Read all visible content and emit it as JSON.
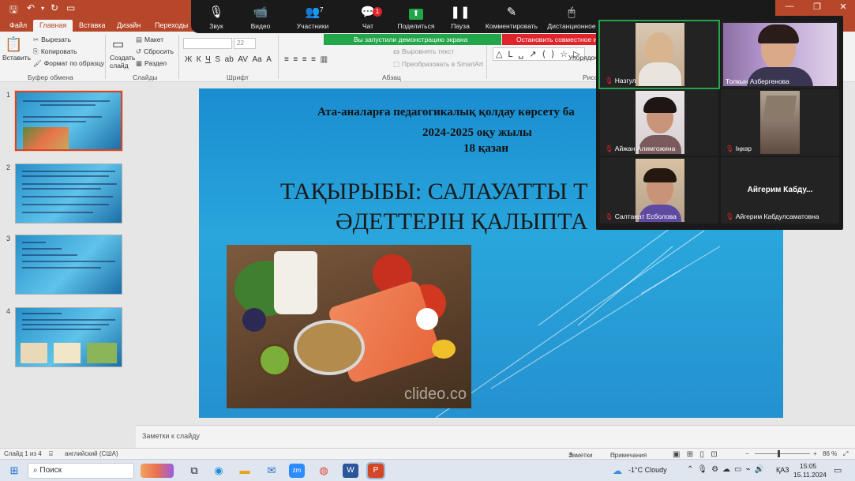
{
  "titlebar": {
    "color": "#b7472a",
    "save_icon": "save-icon",
    "undo_icon": "undo-icon",
    "restore_icon": "restore-icon",
    "close_icon": "close-icon"
  },
  "ribbon_tabs": [
    "Файл",
    "Главная",
    "Вставка",
    "Дизайн",
    "Переходы"
  ],
  "ribbon": {
    "paste": "Вставить",
    "cut": "Вырезать",
    "copy": "Копировать",
    "format_painter": "Формат по образцу",
    "clipboard_group": "Буфер обмена",
    "new_slide": "Создать слайд",
    "layout": "Макет",
    "reset": "Сбросить",
    "section": "Раздел",
    "slides_group": "Слайды",
    "font_size": "22",
    "font_group": "Шрифт",
    "paragraph_group": "Абзац",
    "align_text": "Выровнять текст",
    "convert_smartart": "Преобразовать в SmartArt",
    "arrange": "Упорядоч",
    "drawing_group_partial": "Рисо"
  },
  "zoom_toolbar": {
    "items": [
      {
        "icon": "microphone-icon",
        "label": "Звук"
      },
      {
        "icon": "video-camera-icon",
        "label": "Видео"
      },
      {
        "icon": "participants-icon",
        "label": "Участники",
        "count": "7"
      },
      {
        "icon": "chat-icon",
        "label": "Чат",
        "badge": "1"
      },
      {
        "icon": "share-screen-icon",
        "label": "Поделиться"
      },
      {
        "icon": "pause-icon",
        "label": "Пауза"
      },
      {
        "icon": "annotate-icon",
        "label": "Комментировать"
      },
      {
        "icon": "remote-control-icon",
        "label": "Дистанционное"
      }
    ],
    "sharing_notice": "Вы запустили демонстрацию экрана",
    "stop_sharing": "Остановить совместное испо"
  },
  "thumbnails": [
    {
      "number": "1",
      "selected": true
    },
    {
      "number": "2",
      "selected": false
    },
    {
      "number": "3",
      "selected": false
    },
    {
      "number": "4",
      "selected": false
    }
  ],
  "slide": {
    "line1": "Ата-аналарға педагогикалық қолдау көрсету ба",
    "line2": "2024-2025 оқу жылы",
    "line3": "18 қазан",
    "title_line1": "ТАҚЫРЫБЫ: САЛАУАТТЫ Т",
    "title_line2": "ӘДЕТТЕРІН ҚАЛЫПТА",
    "watermark": "clideo.co"
  },
  "notes_placeholder": "Заметки к слайду",
  "statusbar": {
    "slide_counter": "Слайд 1 из 4",
    "language": "английский (США)",
    "notes": "Заметки",
    "comments": "Примечания",
    "zoom": "86 %"
  },
  "taskbar": {
    "search": "Поиск",
    "weather": "-1°C  Cloudy",
    "keyboard": "ҚАЗ",
    "time": "15:05",
    "date": "15.11.2024"
  },
  "participants": [
    {
      "name": "Назгул",
      "active": true
    },
    {
      "name": "Толкын Азбергенова",
      "active": false
    },
    {
      "name": "Айжан Алимгожина",
      "active": false
    },
    {
      "name": "Іңкәр",
      "active": false
    },
    {
      "name": "Салтанат Есболова",
      "active": false
    },
    {
      "name": "Айгерим Кабдулсаматовна",
      "active": false,
      "display_text": "Айгерим Кабду..."
    }
  ]
}
